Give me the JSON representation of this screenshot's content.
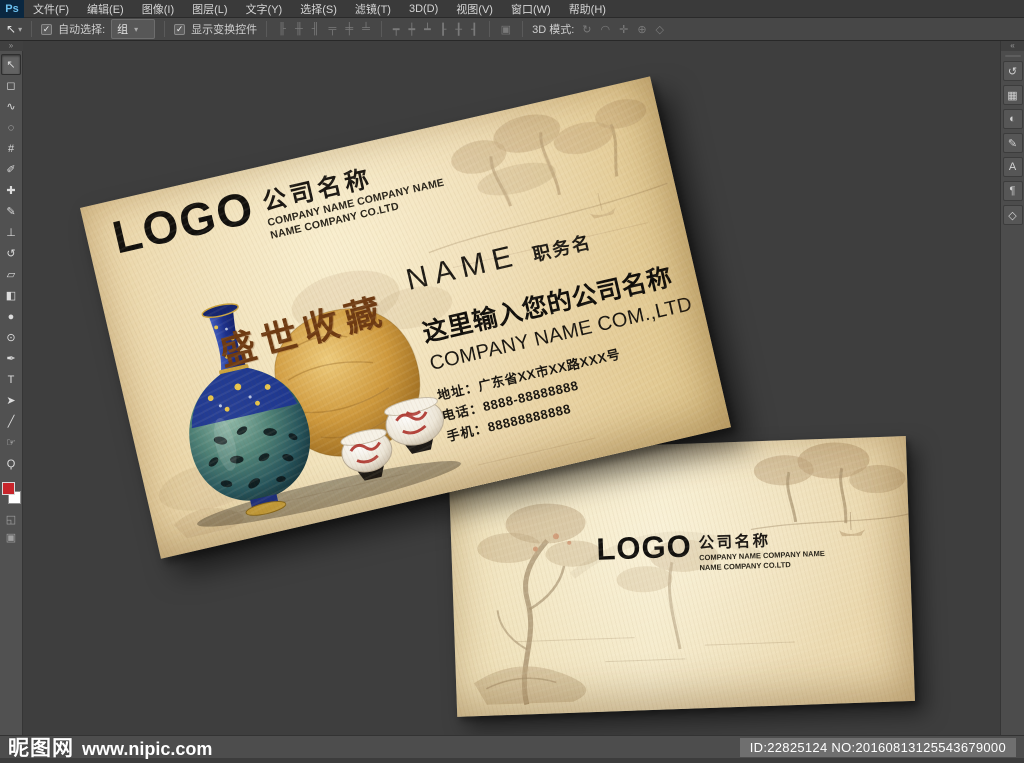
{
  "app": {
    "logo_badge": "Ps",
    "menus": [
      {
        "name": "menu-file",
        "label": "文件(F)"
      },
      {
        "name": "menu-edit",
        "label": "编辑(E)"
      },
      {
        "name": "menu-image",
        "label": "图像(I)"
      },
      {
        "name": "menu-layer",
        "label": "图层(L)"
      },
      {
        "name": "menu-type",
        "label": "文字(Y)"
      },
      {
        "name": "menu-select",
        "label": "选择(S)"
      },
      {
        "name": "menu-filter",
        "label": "滤镜(T)"
      },
      {
        "name": "menu-3d",
        "label": "3D(D)"
      },
      {
        "name": "menu-view",
        "label": "视图(V)"
      },
      {
        "name": "menu-window",
        "label": "窗口(W)"
      },
      {
        "name": "menu-help",
        "label": "帮助(H)"
      }
    ]
  },
  "options_bar": {
    "tool_glyph": "↖",
    "dropdown_caret": "▾",
    "checkbox_check": "✓",
    "auto_select": {
      "label": "自动选择:",
      "value": "组"
    },
    "show_transform_label": "显示变换控件",
    "align_icons": [
      {
        "name": "align-left-edges-icon",
        "glyph": "╟"
      },
      {
        "name": "align-horizontal-centers-icon",
        "glyph": "╫"
      },
      {
        "name": "align-right-edges-icon",
        "glyph": "╢"
      },
      {
        "name": "align-top-edges-icon",
        "glyph": "╤"
      },
      {
        "name": "align-vertical-centers-icon",
        "glyph": "╪"
      },
      {
        "name": "align-bottom-edges-icon",
        "glyph": "╧"
      }
    ],
    "distribute_icons": [
      {
        "name": "distribute-top-icon",
        "glyph": "┯"
      },
      {
        "name": "distribute-vcenter-icon",
        "glyph": "┿"
      },
      {
        "name": "distribute-bottom-icon",
        "glyph": "┷"
      },
      {
        "name": "distribute-left-icon",
        "glyph": "┠"
      },
      {
        "name": "distribute-hcenter-icon",
        "glyph": "╂"
      },
      {
        "name": "distribute-right-icon",
        "glyph": "┨"
      }
    ],
    "auto_align_glyph": "▣",
    "mode_3d_label": "3D 模式:",
    "mode_3d_icons": [
      {
        "name": "3d-rotate-icon",
        "glyph": "↻"
      },
      {
        "name": "3d-roll-icon",
        "glyph": "◠"
      },
      {
        "name": "3d-drag-icon",
        "glyph": "✛"
      },
      {
        "name": "3d-slide-icon",
        "glyph": "⊕"
      },
      {
        "name": "3d-scale-icon",
        "glyph": "◇"
      }
    ]
  },
  "toolbar": {
    "collapse_glyph": "»",
    "tools": [
      {
        "name": "move-tool",
        "glyph": "↖",
        "selected": true
      },
      {
        "name": "marquee-tool",
        "glyph": "◻"
      },
      {
        "name": "lasso-tool",
        "glyph": "∿"
      },
      {
        "name": "quick-selection-tool",
        "glyph": "◌"
      },
      {
        "name": "crop-tool",
        "glyph": "#"
      },
      {
        "name": "eyedropper-tool",
        "glyph": "✐"
      },
      {
        "name": "healing-brush-tool",
        "glyph": "✚"
      },
      {
        "name": "brush-tool",
        "glyph": "✎"
      },
      {
        "name": "clone-stamp-tool",
        "glyph": "⊥"
      },
      {
        "name": "history-brush-tool",
        "glyph": "↺"
      },
      {
        "name": "eraser-tool",
        "glyph": "▱"
      },
      {
        "name": "gradient-tool",
        "glyph": "◧"
      },
      {
        "name": "blur-tool",
        "glyph": "●"
      },
      {
        "name": "dodge-tool",
        "glyph": "⊙"
      },
      {
        "name": "pen-tool",
        "glyph": "✒"
      },
      {
        "name": "type-tool",
        "glyph": "T"
      },
      {
        "name": "path-selection-tool",
        "glyph": "➤"
      },
      {
        "name": "line-tool",
        "glyph": "╱"
      },
      {
        "name": "hand-tool",
        "glyph": "☞"
      },
      {
        "name": "zoom-tool",
        "glyph": "Ϙ"
      }
    ],
    "foreground_color": "#c8252b",
    "background_color": "#ffffff",
    "quick_mask_glyph": "◱",
    "screen_mode_glyph": "▣"
  },
  "dock": {
    "collapse_glyph": "«",
    "panels": [
      {
        "name": "history-panel-icon",
        "glyph": "↺"
      },
      {
        "name": "swatches-panel-icon",
        "glyph": "▦"
      },
      {
        "name": "adjustments-panel-icon",
        "glyph": "◐"
      },
      {
        "name": "brush-panel-icon",
        "glyph": "✎"
      },
      {
        "name": "character-panel-icon",
        "glyph": "A"
      },
      {
        "name": "paragraph-panel-icon",
        "glyph": "¶"
      },
      {
        "name": "threed-panel-icon",
        "glyph": "◇"
      }
    ]
  },
  "front_card": {
    "logo": "LOGO",
    "company_cn": "公司名称",
    "company_en_line1": "COMPANY NAME COMPANY NAME",
    "company_en_line2": "NAME COMPANY CO.LTD",
    "person_name": "NAME",
    "person_title": "职务名",
    "calligraphy": "盛世收藏",
    "slogan_cn": "这里输入您的公司名称",
    "slogan_en": "COMPANY NAME COM.,LTD",
    "contact_rows": [
      {
        "label": "地址：",
        "value": "广东省XX市XX路XXX号"
      },
      {
        "label": "电话：",
        "value": "8888-88888888"
      },
      {
        "label": "手机：",
        "value": "88888888888"
      }
    ]
  },
  "back_card": {
    "logo": "LOGO",
    "company_cn": "公司名称",
    "company_en_line1": "COMPANY NAME COMPANY NAME",
    "company_en_line2": "NAME COMPANY CO.LTD"
  },
  "status_bar": {
    "site_name": "昵图网",
    "site_url": "www.nipic.com",
    "id_text": "ID:22825124 NO:20160813125543679000"
  }
}
